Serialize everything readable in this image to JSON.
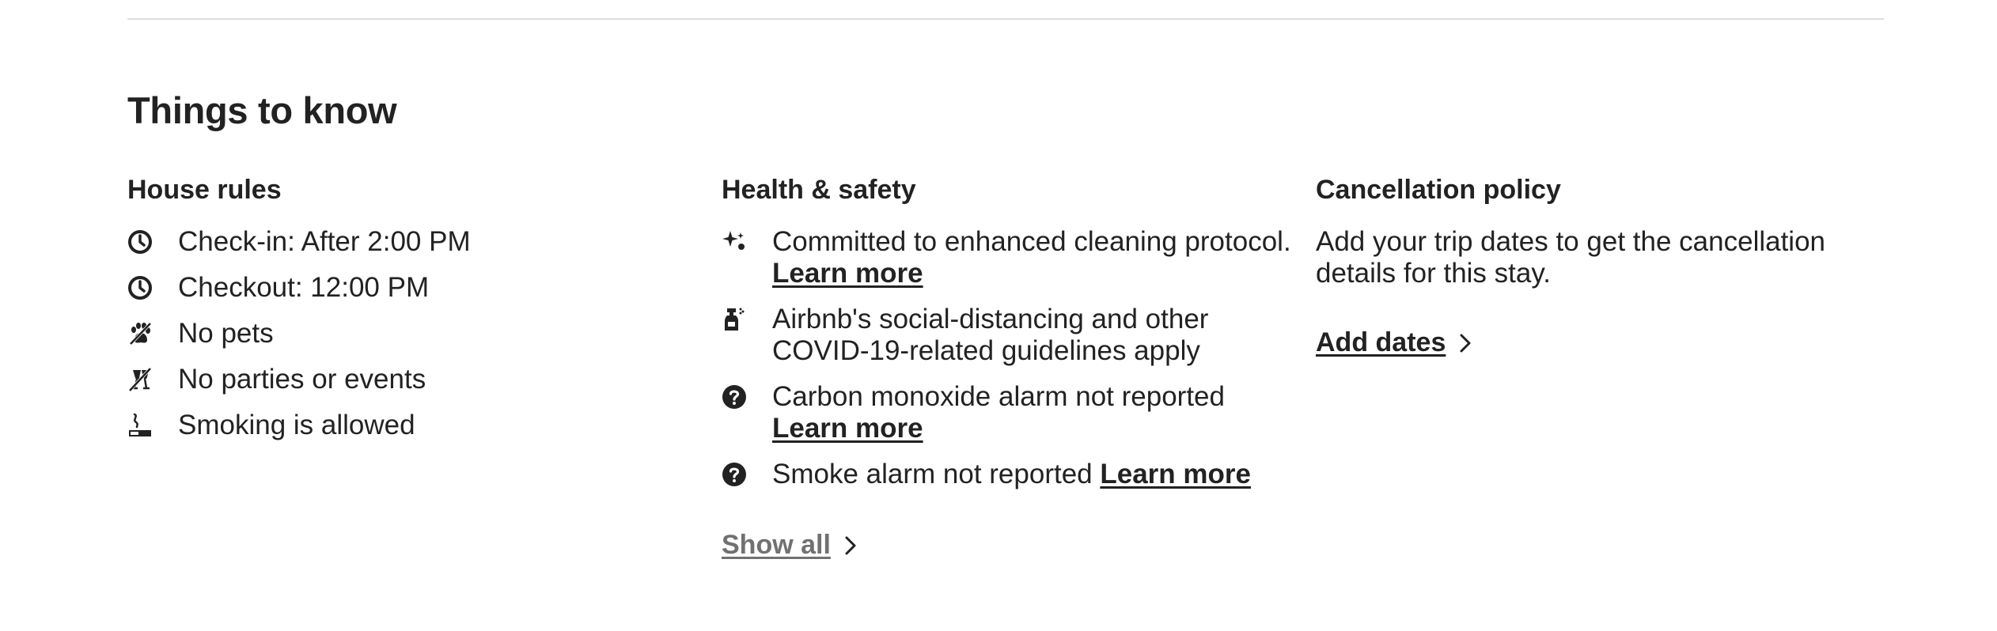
{
  "section": {
    "title": "Things to know"
  },
  "house_rules": {
    "heading": "House rules",
    "items": [
      {
        "icon": "clock-icon",
        "text": "Check-in: After 2:00 PM"
      },
      {
        "icon": "clock-icon",
        "text": "Checkout: 12:00 PM"
      },
      {
        "icon": "no-pets-icon",
        "text": "No pets"
      },
      {
        "icon": "no-parties-icon",
        "text": "No parties or events"
      },
      {
        "icon": "smoking-icon",
        "text": "Smoking is allowed"
      }
    ]
  },
  "health_safety": {
    "heading": "Health & safety",
    "items": [
      {
        "icon": "sparkles-icon",
        "text": "Committed to enhanced cleaning protocol.",
        "link": "Learn more"
      },
      {
        "icon": "spray-bottle-icon",
        "text": "Airbnb's social-distancing and other COVID-19-related guidelines apply",
        "link": ""
      },
      {
        "icon": "question-circle-icon",
        "text": "Carbon monoxide alarm not reported",
        "link": "Learn more"
      },
      {
        "icon": "question-circle-icon",
        "text": "Smoke alarm not reported",
        "link": "Learn more"
      }
    ],
    "show_all": "Show all"
  },
  "cancellation": {
    "heading": "Cancellation policy",
    "text": "Add your trip dates to get the cancellation details for this stay.",
    "add_dates": "Add dates"
  },
  "colors": {
    "text": "#222222",
    "muted": "#717171",
    "divider": "#dddddd"
  }
}
